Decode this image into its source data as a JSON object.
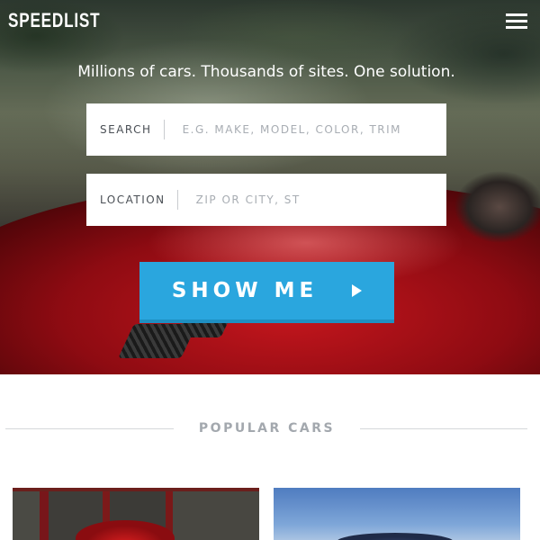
{
  "app": {
    "logo_text": "SPEEDLIST"
  },
  "hero": {
    "tagline": "Millions of cars. Thousands of sites. One solution.",
    "search": {
      "label": "SEARCH",
      "placeholder": "E.G. MAKE, MODEL, COLOR, TRIM",
      "value": ""
    },
    "location": {
      "label": "LOCATION",
      "placeholder": "ZIP OR CITY, ST",
      "value": ""
    },
    "show_button_label": "SHOW ME"
  },
  "popular": {
    "title": "POPULAR CARS",
    "cards": [
      {
        "image": "red-sports-car-photo"
      },
      {
        "image": "blue-car-photo"
      }
    ]
  },
  "colors": {
    "accent": "#2aa6de",
    "heading_gray": "#a3a8ae",
    "hero_car_red": "#c4161d"
  },
  "icons": [
    "hamburger-menu-icon",
    "play-arrow-icon"
  ]
}
